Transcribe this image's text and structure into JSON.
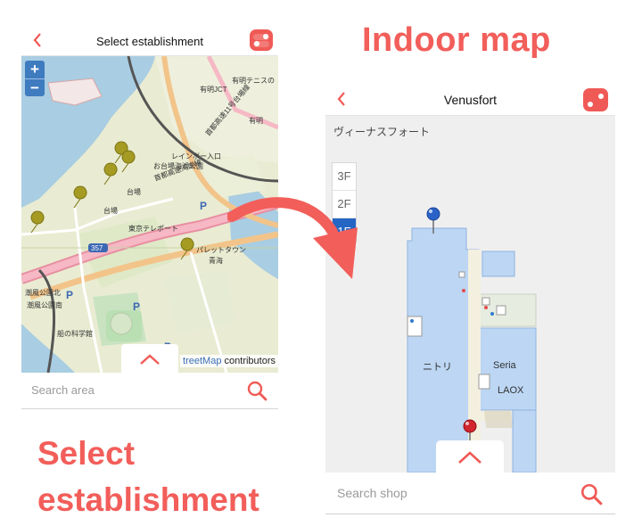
{
  "left_screen": {
    "title": "Select establishment",
    "map": {
      "zoom_in": "+",
      "zoom_out": "−",
      "labels": {
        "route": "357",
        "parking": "P",
        "park": "お台場海浜公園",
        "station": "台場",
        "rainbow": "レインボー入口",
        "ariake_jct": "有明JCT",
        "ariake_tennis": "有明テニスの",
        "shiokaze": "潮風公園北",
        "shiokaze2": "潮風公園南",
        "palette": "パレットタウン",
        "aomi": "青海",
        "kagaku": "船の科学館",
        "daiba": "台場",
        "shutoko": "首都高速湾岸線",
        "shutoko2": "首都高速11号台場線",
        "tokyo_teleport": "東京テレポート",
        "ariake": "有明"
      },
      "attribution_link": "treetMap",
      "attribution_rest": " contributors"
    },
    "search_placeholder": "Search area"
  },
  "right_screen": {
    "title": "Venusfort",
    "venue_name_jp": "ヴィーナスフォート",
    "floors": [
      "3F",
      "2F",
      "1F"
    ],
    "selected_floor": "1F",
    "shops": [
      "ニトリ",
      "Seria",
      "LAOX"
    ],
    "search_placeholder": "Search shop"
  },
  "captions": {
    "indoor_map": "Indoor map",
    "select_line1": "Select",
    "select_line2": "establishment"
  },
  "colors": {
    "accent": "#f25e5a",
    "floor_active": "#2566c5",
    "room_fill": "#bcd6f4",
    "map_water": "#a9cde2"
  }
}
